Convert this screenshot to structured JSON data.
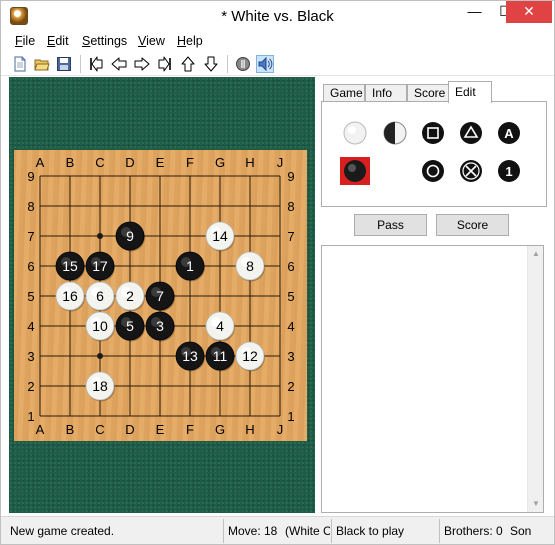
{
  "window": {
    "title": "* White vs. Black",
    "minimize": "—",
    "maximize": "☐",
    "close": "✕"
  },
  "menu": [
    {
      "acc": "F",
      "rest": "ile"
    },
    {
      "acc": "E",
      "rest": "dit"
    },
    {
      "acc": "S",
      "rest": "ettings"
    },
    {
      "acc": "V",
      "rest": "iew"
    },
    {
      "acc": "H",
      "rest": "elp"
    }
  ],
  "toolbar": [
    "new-icon",
    "open-icon",
    "save-icon",
    "first-move-icon",
    "back-icon",
    "forward-icon",
    "last-move-icon",
    "up-icon",
    "down-icon",
    "info-icon",
    "sound-icon"
  ],
  "board": {
    "size": 9,
    "cols": [
      "A",
      "B",
      "C",
      "D",
      "E",
      "F",
      "G",
      "H",
      "J"
    ],
    "rows": [
      "9",
      "8",
      "7",
      "6",
      "5",
      "4",
      "3",
      "2",
      "1"
    ],
    "hoshi": [
      "C7",
      "G7",
      "E5",
      "C3",
      "G3"
    ],
    "stones": [
      {
        "color": "black",
        "point": "F6",
        "num": 1
      },
      {
        "color": "white",
        "point": "D5",
        "num": 2
      },
      {
        "color": "black",
        "point": "E4",
        "num": 3
      },
      {
        "color": "white",
        "point": "G4",
        "num": 4
      },
      {
        "color": "black",
        "point": "D4",
        "num": 5
      },
      {
        "color": "white",
        "point": "C5",
        "num": 6
      },
      {
        "color": "black",
        "point": "E5",
        "num": 7
      },
      {
        "color": "white",
        "point": "H6",
        "num": 8
      },
      {
        "color": "black",
        "point": "D7",
        "num": 9
      },
      {
        "color": "white",
        "point": "C4",
        "num": 10
      },
      {
        "color": "black",
        "point": "G3",
        "num": 11
      },
      {
        "color": "white",
        "point": "H3",
        "num": 12
      },
      {
        "color": "black",
        "point": "F3",
        "num": 13
      },
      {
        "color": "white",
        "point": "G7",
        "num": 14
      },
      {
        "color": "black",
        "point": "B6",
        "num": 15
      },
      {
        "color": "white",
        "point": "B5",
        "num": 16
      },
      {
        "color": "black",
        "point": "C6",
        "num": 17
      },
      {
        "color": "white",
        "point": "C2",
        "num": 18
      }
    ]
  },
  "tabs": [
    "Game",
    "Info",
    "Score",
    "Edit"
  ],
  "active_tab": "Edit",
  "edit_tools": [
    "white-stone-icon",
    "alternate-stone-icon",
    "square-mark-icon",
    "triangle-mark-icon",
    "letter-mark-icon",
    "black-stone-selected-icon",
    "circle-mark-icon",
    "cross-mark-icon",
    "number-mark-icon"
  ],
  "buttons": {
    "pass": "Pass",
    "score": "Score"
  },
  "status": {
    "message": "New game created.",
    "move": "Move: 18",
    "move_detail": "(White C",
    "to_play": "Black to play",
    "brothers": "Brothers: 0",
    "sons": "Son"
  }
}
